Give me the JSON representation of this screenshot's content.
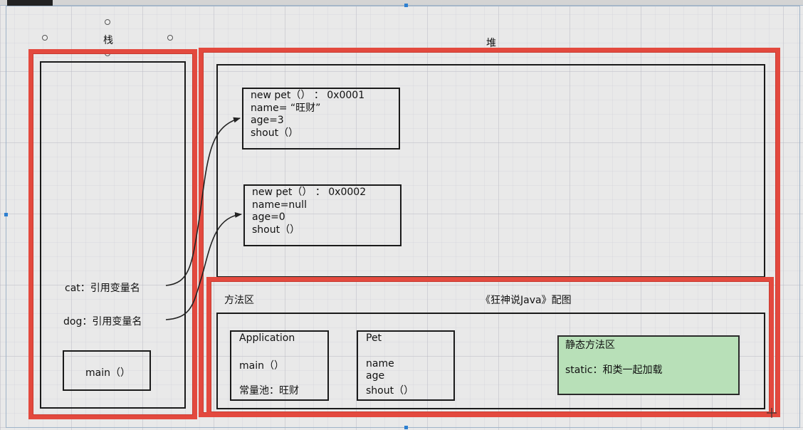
{
  "stack": {
    "title": "栈",
    "variables": [
      "cat：引用变量名",
      "dog：引用变量名"
    ],
    "main_frame": "main（）"
  },
  "heap": {
    "title": "堆",
    "objects": [
      {
        "lines": [
          "new pet（）   ：  0x0001",
          "name= “旺财”",
          "age=3",
          "shout（）"
        ]
      },
      {
        "lines": [
          "new pet（）   ：  0x0002",
          "name=null",
          "age=0",
          "shout（）"
        ]
      }
    ]
  },
  "method_area": {
    "title": "方法区",
    "caption": "《狂神说Java》配图",
    "application_class": {
      "name": "Application",
      "method": "main（）",
      "constant_pool": "常量池：旺财"
    },
    "pet_class": {
      "name": "Pet",
      "members": [
        "name",
        "age",
        "shout（）"
      ]
    },
    "static_area": {
      "title": "静态方法区",
      "note": "static：和类一起加载",
      "color": "#b8e0b8"
    }
  },
  "colors": {
    "highlight_border": "#e3493e",
    "canvas": "#e9e9e9"
  }
}
